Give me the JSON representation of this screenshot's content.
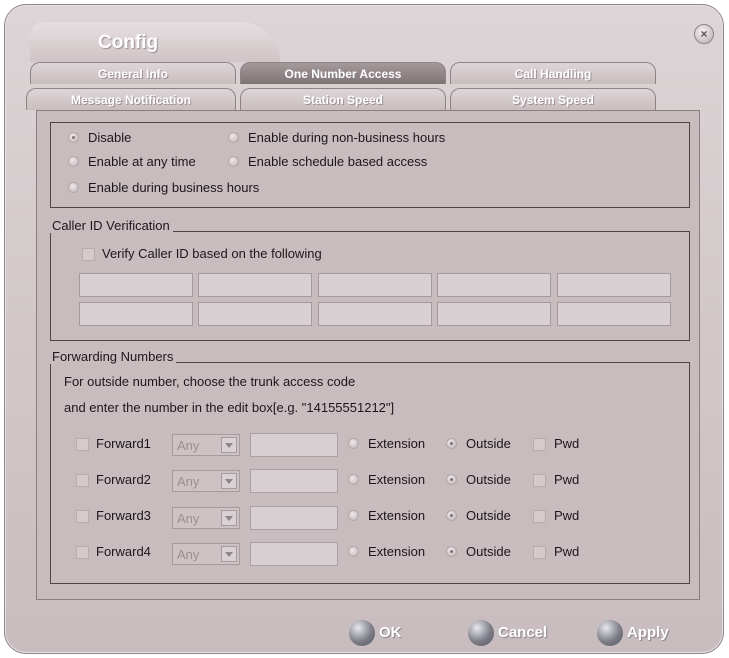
{
  "window": {
    "title": "Config",
    "close_glyph": "×"
  },
  "tabs_row1": [
    {
      "label": "General Info",
      "active": false
    },
    {
      "label": "One Number Access",
      "active": true
    },
    {
      "label": "Call Handling",
      "active": false
    }
  ],
  "tabs_row2": [
    {
      "label": "Message Notification"
    },
    {
      "label": "Station Speed"
    },
    {
      "label": "System Speed"
    }
  ],
  "access_mode": {
    "selected": "Disable",
    "options": [
      "Disable",
      "Enable during non-business hours",
      "Enable at any time",
      "Enable schedule based access",
      "Enable during business hours"
    ]
  },
  "caller_id": {
    "group_label": "Caller ID Verification",
    "verify_label": "Verify Caller ID based on the following",
    "verify_checked": false,
    "grid_values": [
      [
        "",
        "",
        "",
        "",
        ""
      ],
      [
        "",
        "",
        "",
        "",
        ""
      ]
    ]
  },
  "forwarding": {
    "group_label": "Forwarding Numbers",
    "info_line1": "For outside number, choose the trunk access code",
    "info_line2": "and enter the number in the edit box[e.g. \"14155551212\"]",
    "rows": [
      {
        "label": "Forward1",
        "checked": false,
        "trunk": "Any",
        "number": "",
        "type": "Outside",
        "pwd": false
      },
      {
        "label": "Forward2",
        "checked": false,
        "trunk": "Any",
        "number": "",
        "type": "Outside",
        "pwd": false
      },
      {
        "label": "Forward3",
        "checked": false,
        "trunk": "Any",
        "number": "",
        "type": "Outside",
        "pwd": false
      },
      {
        "label": "Forward4",
        "checked": false,
        "trunk": "Any",
        "number": "",
        "type": "Outside",
        "pwd": false
      }
    ],
    "extension_label": "Extension",
    "outside_label": "Outside",
    "pwd_label": "Pwd"
  },
  "buttons": {
    "ok": "OK",
    "cancel": "Cancel",
    "apply": "Apply"
  },
  "colors": {
    "dialog_bg": "#c8bcbe",
    "active_tab": "#8a8082",
    "button_orb": "#6e6e7a"
  }
}
